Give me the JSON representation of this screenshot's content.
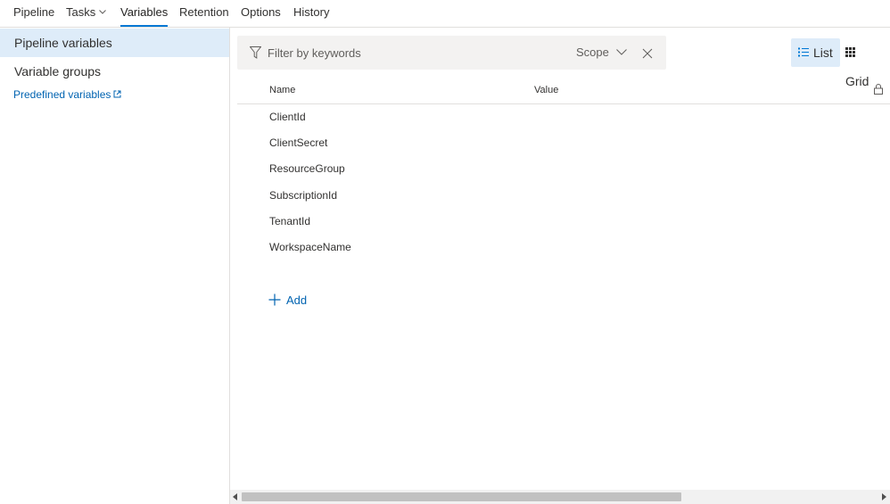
{
  "tabs": [
    {
      "label": "Pipeline"
    },
    {
      "label": "Tasks"
    },
    {
      "label": "Variables"
    },
    {
      "label": "Retention"
    },
    {
      "label": "Options"
    },
    {
      "label": "History"
    }
  ],
  "active_tab": "Variables",
  "sidebar": {
    "items": [
      {
        "label": "Pipeline variables"
      },
      {
        "label": "Variable groups"
      }
    ],
    "link": {
      "label": "Predefined variables"
    }
  },
  "filter": {
    "placeholder": "Filter by keywords",
    "scope_label": "Scope"
  },
  "view": {
    "list_label": "List",
    "grid_label": "Grid"
  },
  "table": {
    "columns": {
      "name": "Name",
      "value": "Value"
    },
    "rows": [
      {
        "name": "ClientId"
      },
      {
        "name": "ClientSecret"
      },
      {
        "name": "ResourceGroup"
      },
      {
        "name": "SubscriptionId"
      },
      {
        "name": "TenantId"
      },
      {
        "name": "WorkspaceName"
      }
    ]
  },
  "add_label": "Add",
  "icons": {
    "filter": "filter-icon",
    "scope": "chevron-down-icon",
    "clear": "close-icon",
    "list": "list-icon",
    "grid": "grid-icon",
    "lock": "lock-icon",
    "add": "plus-icon",
    "external": "external-link-icon"
  },
  "colors": {
    "accent": "#0078d4",
    "link": "#0063b1",
    "selected_bg": "#deecf9",
    "filter_bg": "#f3f2f1"
  }
}
